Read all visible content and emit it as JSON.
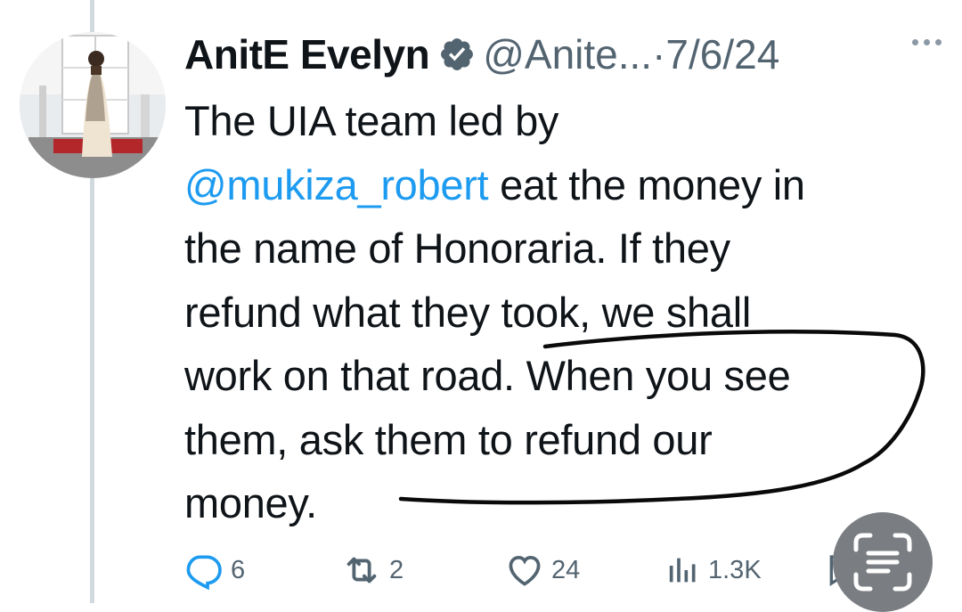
{
  "author": {
    "display_name": "AnitE Evelyn",
    "handle": "@Anite...",
    "separator": "·",
    "date": "7/6/24",
    "verified": true
  },
  "tweet": {
    "text_line1": "The UIA team led by",
    "mention": "@mukiza_robert",
    "text_after_mention": " eat the money in",
    "text_line3": "the name of Honoraria. If they",
    "text_line4": "refund what they took, we shall",
    "text_line5": "work on that road. When you see",
    "text_line6": "them, ask them to refund our",
    "text_line7": "money."
  },
  "actions": {
    "replies": "6",
    "reposts": "2",
    "likes": "24",
    "views": "1.3K"
  },
  "colors": {
    "link": "#1d9bf0",
    "muted": "#536471",
    "verified_badge": "#536471",
    "thread_line": "#cfd9de"
  },
  "icons": [
    "more-icon",
    "verified-badge-icon",
    "reply-icon",
    "repost-icon",
    "like-icon",
    "views-icon",
    "bookmark-icon",
    "scan-text-icon"
  ]
}
